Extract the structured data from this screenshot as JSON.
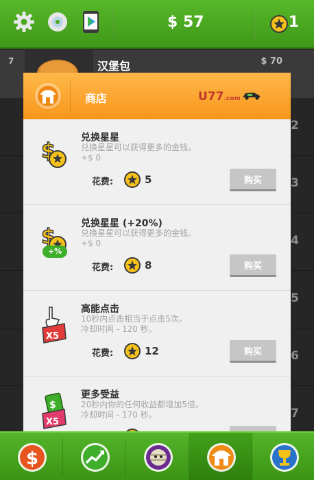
{
  "header": {
    "money": "$ 57",
    "stars": "1"
  },
  "background": {
    "first_row": {
      "level": "7",
      "title": "汉堡包",
      "price": "$ 70"
    },
    "row_numbers": [
      "2",
      "3",
      "4",
      "5",
      "6",
      "7"
    ]
  },
  "shop": {
    "title": "商店",
    "logo_text": "U77",
    "logo_sub": ".com",
    "cost_label": "花费:",
    "buy_label": "购买",
    "items": [
      {
        "name": "兑换星星",
        "desc1": "兑换星星可以获得更多的金钱。",
        "desc2": "+$ 0",
        "cost": "5"
      },
      {
        "name": "兑换星星 (+20%)",
        "desc1": "兑换星星可以获得更多的金钱。",
        "desc2": "+$ 0",
        "cost": "8",
        "badge": "+%"
      },
      {
        "name": "高能点击",
        "desc1": "10秒内点击相当于点击5次。",
        "desc2": "冷却时间 - 120 秒。",
        "cost": "12"
      },
      {
        "name": "更多受益",
        "desc1": "20秒内你的任何收益都增加5倍。",
        "desc2": "冷却时间 - 170 秒。",
        "cost": ""
      }
    ]
  },
  "colors": {
    "green": "#4fae24",
    "orange": "#f8961b",
    "star": "#f6c21a"
  }
}
